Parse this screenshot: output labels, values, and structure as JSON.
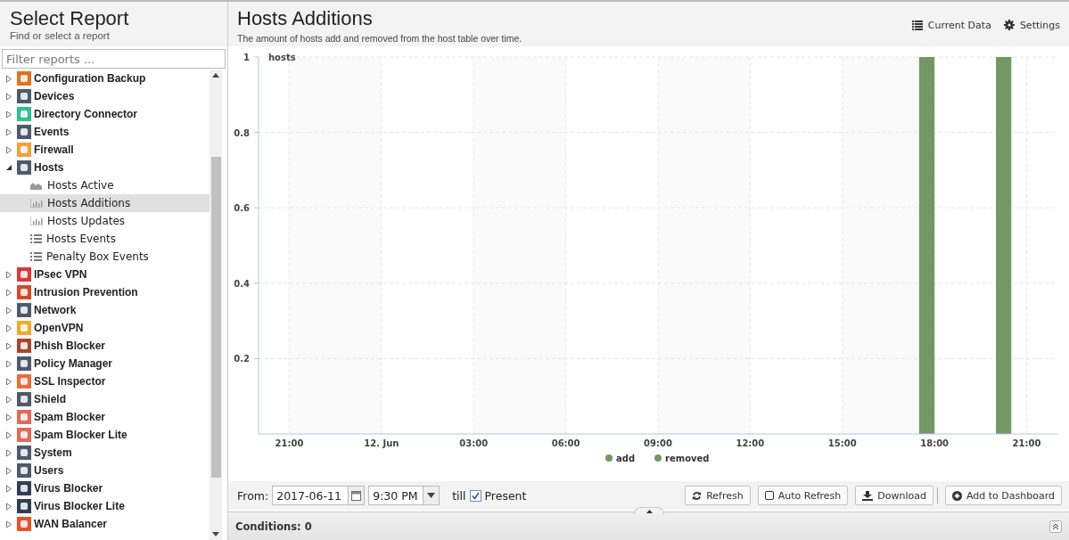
{
  "sidebar": {
    "title": "Select Report",
    "subtitle": "Find or select a report",
    "filter": {
      "placeholder": "Filter reports ..."
    },
    "items": [
      {
        "label": "Configuration Backup",
        "color": "#e0731f",
        "expanded": false,
        "selected": false
      },
      {
        "label": "Devices",
        "color": "#4d5a6b",
        "expanded": false,
        "selected": false
      },
      {
        "label": "Directory Connector",
        "color": "#2fbf8f",
        "expanded": false,
        "selected": false
      },
      {
        "label": "Events",
        "color": "#4d5a6b",
        "expanded": false,
        "selected": false
      },
      {
        "label": "Firewall",
        "color": "#f2a03a",
        "expanded": false,
        "selected": false
      },
      {
        "label": "Hosts",
        "color": "#4d5a6b",
        "expanded": true,
        "selected": false,
        "children": [
          {
            "label": "Hosts Active",
            "kind": "area",
            "selected": false
          },
          {
            "label": "Hosts Additions",
            "kind": "bar",
            "selected": true
          },
          {
            "label": "Hosts Updates",
            "kind": "bar",
            "selected": false
          },
          {
            "label": "Hosts Events",
            "kind": "list",
            "selected": false
          },
          {
            "label": "Penalty Box Events",
            "kind": "list",
            "selected": false
          }
        ]
      },
      {
        "label": "IPsec VPN",
        "color": "#d93a3a",
        "expanded": false,
        "selected": false
      },
      {
        "label": "Intrusion Prevention",
        "color": "#d9462a",
        "expanded": false,
        "selected": false
      },
      {
        "label": "Network",
        "color": "#4d5a6b",
        "expanded": false,
        "selected": false
      },
      {
        "label": "OpenVPN",
        "color": "#f0a92c",
        "expanded": false,
        "selected": false
      },
      {
        "label": "Phish Blocker",
        "color": "#a8452a",
        "expanded": false,
        "selected": false
      },
      {
        "label": "Policy Manager",
        "color": "#4d5a6b",
        "expanded": false,
        "selected": false
      },
      {
        "label": "SSL Inspector",
        "color": "#f06a3a",
        "expanded": false,
        "selected": false
      },
      {
        "label": "Shield",
        "color": "#4d5a6b",
        "expanded": false,
        "selected": false
      },
      {
        "label": "Spam Blocker",
        "color": "#e06a5a",
        "expanded": false,
        "selected": false
      },
      {
        "label": "Spam Blocker Lite",
        "color": "#e06a5a",
        "expanded": false,
        "selected": false
      },
      {
        "label": "System",
        "color": "#4d5a6b",
        "expanded": false,
        "selected": false
      },
      {
        "label": "Users",
        "color": "#4d5a6b",
        "expanded": false,
        "selected": false
      },
      {
        "label": "Virus Blocker",
        "color": "#2f3e55",
        "expanded": false,
        "selected": false
      },
      {
        "label": "Virus Blocker Lite",
        "color": "#2f3e55",
        "expanded": false,
        "selected": false
      },
      {
        "label": "WAN Balancer",
        "color": "#e8512a",
        "expanded": false,
        "selected": false
      }
    ]
  },
  "report": {
    "title": "Hosts Additions",
    "description": "The amount of hosts add and removed from the host table over time.",
    "actions": [
      {
        "kind": "data",
        "label": "Current Data"
      },
      {
        "kind": "settings",
        "label": "Settings"
      }
    ],
    "chart_data": {
      "type": "bar",
      "grid": true,
      "ylabel": "hosts",
      "ylim": [
        0,
        1
      ],
      "categories": [
        null,
        null,
        "21:00",
        null,
        null,
        null,
        null,
        null,
        "12. Jun",
        null,
        null,
        null,
        null,
        null,
        "03:00",
        null,
        null,
        null,
        null,
        null,
        "06:00",
        null,
        null,
        null,
        null,
        null,
        "09:00",
        null,
        null,
        null,
        null,
        null,
        "12:00",
        null,
        null,
        null,
        null,
        null,
        "15:00",
        null,
        null,
        null,
        null,
        null,
        "18:00",
        null,
        null,
        null,
        null,
        null,
        "21:00",
        null
      ],
      "series": [
        {
          "name": "add",
          "color": "#739765",
          "values": [
            null,
            null,
            null,
            null,
            null,
            null,
            null,
            null,
            null,
            null,
            null,
            null,
            null,
            null,
            null,
            null,
            null,
            null,
            null,
            null,
            null,
            null,
            null,
            null,
            null,
            null,
            null,
            null,
            null,
            null,
            null,
            null,
            null,
            null,
            null,
            null,
            null,
            null,
            null,
            null,
            null,
            null,
            null,
            1,
            null,
            null,
            null,
            null,
            1,
            null,
            null,
            null
          ]
        },
        {
          "name": "removed",
          "color": "#739765",
          "values": [
            null,
            null,
            null,
            null,
            null,
            null,
            null,
            null,
            null,
            null,
            null,
            null,
            null,
            null,
            null,
            null,
            null,
            null,
            null,
            null,
            null,
            null,
            null,
            null,
            null,
            null,
            null,
            null,
            null,
            null,
            null,
            null,
            null,
            null,
            null,
            null,
            null,
            null,
            null,
            null,
            null,
            null,
            null,
            null,
            null,
            null,
            null,
            null,
            null,
            null,
            null,
            null
          ]
        }
      ],
      "yticks": [
        {
          "value": 0.2,
          "label": "0.2"
        },
        {
          "value": 0.4,
          "label": "0.4"
        },
        {
          "value": 0.6,
          "label": "0.6"
        },
        {
          "value": 0.8,
          "label": "0.8"
        },
        {
          "value": 1,
          "label": "1"
        }
      ]
    }
  },
  "toolbar": {
    "from_label": "From:",
    "date": "2017-06-11",
    "time": "9:30 PM",
    "till_label": "till",
    "present": {
      "label": "Present",
      "checked": true
    },
    "buttons": [
      {
        "kind": "refresh",
        "label": "Refresh"
      },
      {
        "kind": "toggle",
        "label": "Auto Refresh",
        "checked": false
      },
      {
        "kind": "download",
        "label": "Download"
      },
      {
        "kind": "add",
        "label": "Add to Dashboard"
      }
    ]
  },
  "conditions": {
    "label": "Conditions: 0"
  }
}
